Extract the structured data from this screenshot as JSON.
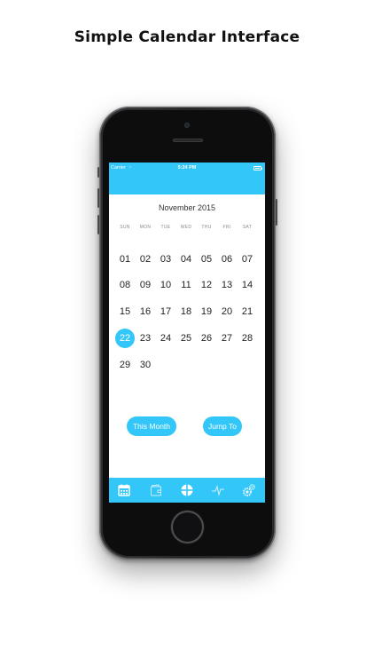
{
  "headline": "Simple Calendar Interface",
  "status_bar": {
    "carrier": "Carrier",
    "time": "5:24 PM",
    "wifi_glyph": "◔"
  },
  "calendar": {
    "month_title": "November 2015",
    "weekdays": [
      "SUN",
      "MON",
      "TUE",
      "WED",
      "THU",
      "FRI",
      "SAT"
    ],
    "first_weekday_index": 0,
    "days": [
      "01",
      "02",
      "03",
      "04",
      "05",
      "06",
      "07",
      "08",
      "09",
      "10",
      "11",
      "12",
      "13",
      "14",
      "15",
      "16",
      "17",
      "18",
      "19",
      "20",
      "21",
      "22",
      "23",
      "24",
      "25",
      "26",
      "27",
      "28",
      "29",
      "30"
    ],
    "selected_day": "22"
  },
  "buttons": {
    "this_month": "This Month",
    "jump_to": "Jump To"
  },
  "tabs": [
    {
      "name": "calendar-icon",
      "active": true
    },
    {
      "name": "wallet-icon",
      "active": false
    },
    {
      "name": "compass-icon",
      "active": false
    },
    {
      "name": "activity-icon",
      "active": false
    },
    {
      "name": "settings-gears-icon",
      "active": false
    }
  ],
  "colors": {
    "accent": "#33c6f8",
    "text": "#222222",
    "weekday": "#8a8a8a"
  }
}
